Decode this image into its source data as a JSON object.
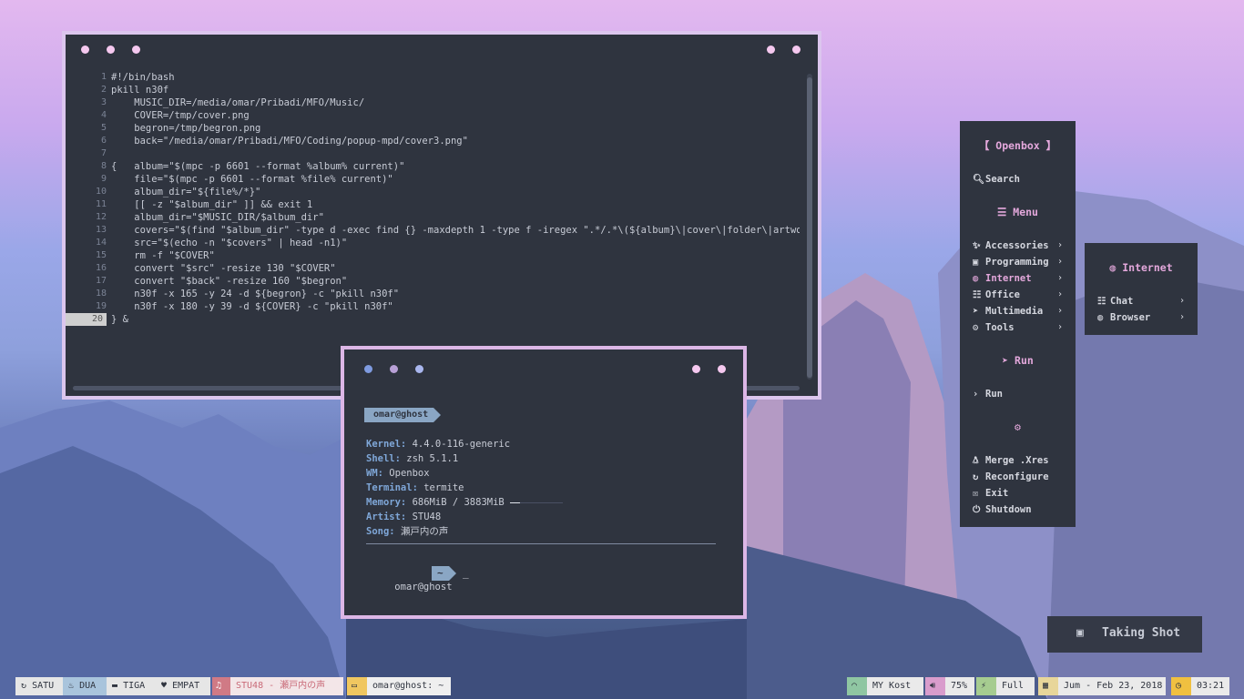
{
  "editor": {
    "lines": [
      {
        "n": "1",
        "t": "#!/bin/bash"
      },
      {
        "n": "2",
        "t": "pkill n30f"
      },
      {
        "n": "3",
        "t": "    MUSIC_DIR=/media/omar/Pribadi/MFO/Music/"
      },
      {
        "n": "4",
        "t": "    COVER=/tmp/cover.png"
      },
      {
        "n": "5",
        "t": "    begron=/tmp/begron.png"
      },
      {
        "n": "6",
        "t": "    back=\"/media/omar/Pribadi/MFO/Coding/popup-mpd/cover3.png\""
      },
      {
        "n": "7",
        "t": ""
      },
      {
        "n": "8",
        "t": "{   album=\"$(mpc -p 6601 --format %album% current)\""
      },
      {
        "n": "9",
        "t": "    file=\"$(mpc -p 6601 --format %file% current)\""
      },
      {
        "n": "10",
        "t": "    album_dir=\"${file%/*}\""
      },
      {
        "n": "11",
        "t": "    [[ -z \"$album_dir\" ]] && exit 1"
      },
      {
        "n": "12",
        "t": "    album_dir=\"$MUSIC_DIR/$album_dir\""
      },
      {
        "n": "13",
        "t": "    covers=\"$(find \"$album_dir\" -type d -exec find {} -maxdepth 1 -type f -iregex \".*/.*\\(${album}\\|cover\\|folder\\|artwork\\|fro"
      },
      {
        "n": "14",
        "t": "    src=\"$(echo -n \"$covers\" | head -n1)\""
      },
      {
        "n": "15",
        "t": "    rm -f \"$COVER\""
      },
      {
        "n": "16",
        "t": "    convert \"$src\" -resize 130 \"$COVER\""
      },
      {
        "n": "17",
        "t": "    convert \"$back\" -resize 160 \"$begron\""
      },
      {
        "n": "18",
        "t": "    n30f -x 165 -y 24 -d ${begron} -c \"pkill n30f\""
      },
      {
        "n": "19",
        "t": "    n30f -x 180 -y 39 -d ${COVER} -c \"pkill n30f\""
      },
      {
        "n": "20",
        "t": "} &"
      }
    ]
  },
  "terminal": {
    "prompt_tag": "omar@ghost",
    "kernel_label": "Kernel:",
    "kernel": "4.4.0-116-generic",
    "shell_label": "Shell:",
    "shell": "zsh 5.1.1",
    "wm_label": "WM:",
    "wm": "Openbox",
    "term_label": "Terminal:",
    "term": "termite",
    "memory_label": "Memory:",
    "memory": "686MiB / 3883MiB",
    "memory_fraction": 0.18,
    "artist_label": "Artist:",
    "artist": "STU48",
    "song_label": "Song:",
    "song": "瀬戸内の声",
    "user": "omar@ghost",
    "cwd": "~",
    "cursor": "_"
  },
  "menu": {
    "title": "Openbox",
    "search": "Search",
    "menu_header": "Menu",
    "items": [
      "Accessories",
      "Programming",
      "Internet",
      "Office",
      "Multimedia",
      "Tools"
    ],
    "run_header": "Run",
    "run": "Run",
    "actions": [
      "Merge .Xres",
      "Reconfigure",
      "Exit",
      "Shutdown"
    ]
  },
  "submenu": {
    "title": "Internet",
    "items": [
      "Chat",
      "Browser"
    ]
  },
  "shot": {
    "label": "Taking Shot"
  },
  "taskbar": {
    "workspaces": [
      "SATU",
      "DUA",
      "TIGA",
      "EMPAT"
    ],
    "now_playing": "STU48 - 瀬戸内の声",
    "window": "omar@ghost: ~",
    "wifi": "MY Kost",
    "volume": "75%",
    "battery": "Full",
    "date": "Jum - Feb 23, 2018",
    "time": "03:21"
  },
  "colors": {
    "accent": "#e4a8dc",
    "panel": "#2f343f",
    "blue": "#7fa7d8"
  }
}
